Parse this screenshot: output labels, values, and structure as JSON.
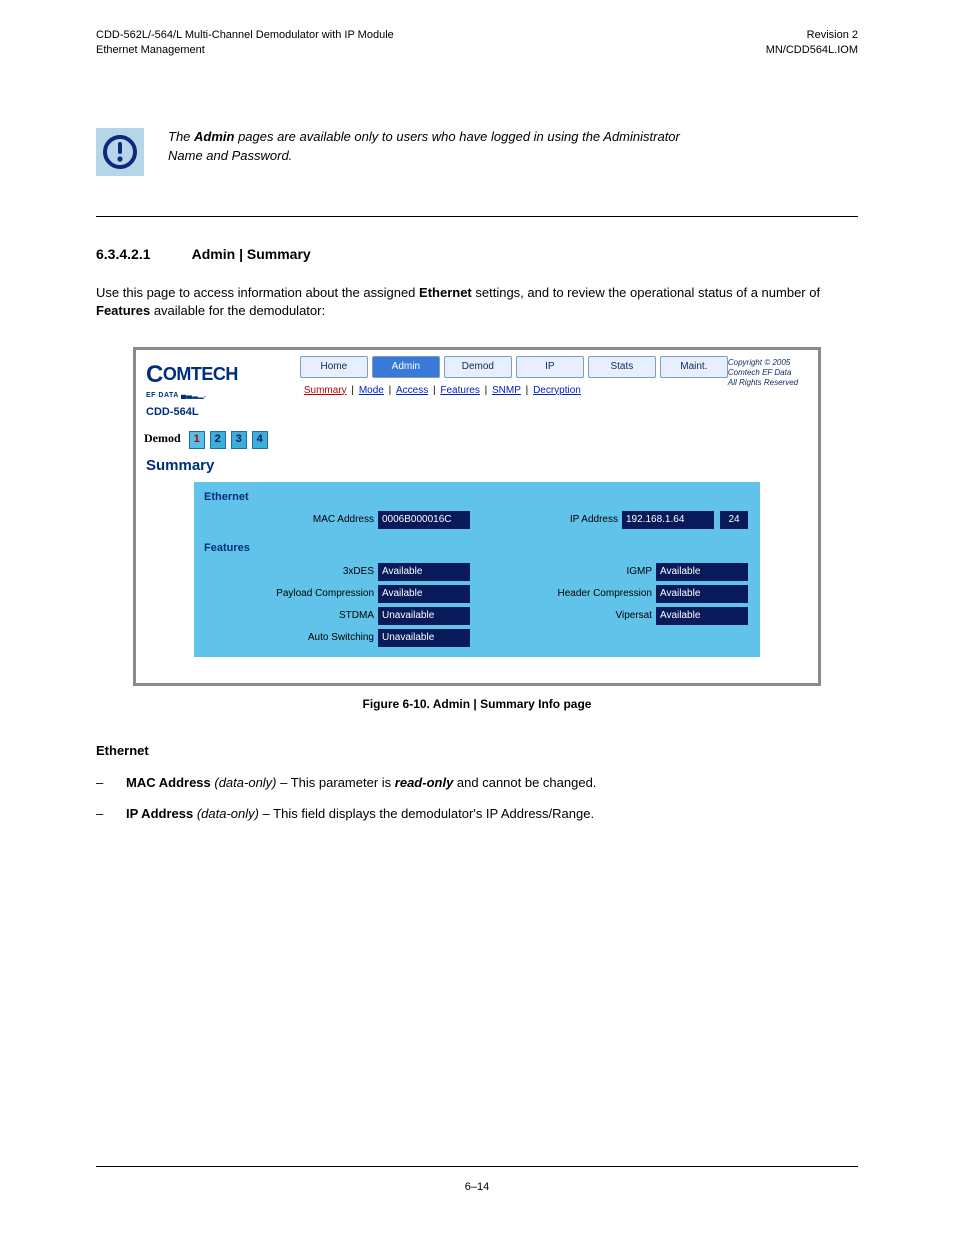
{
  "page_header": {
    "left_line1": "CDD-562L/-564/L Multi-Channel Demodulator with IP Module",
    "left_line2": "Ethernet Management",
    "right_line1": "Revision 2",
    "right_line2": "MN/CDD564L.IOM"
  },
  "notice": {
    "line1_prefix": "The ",
    "line1_italic": "Admin ",
    "line1_rest": "pages are available only to users who have logged in using the Administrator ",
    "line2": "Name and Password."
  },
  "section": {
    "number": "6.3.4.2.1",
    "title": "Admin | Summary",
    "desc_prefix": "Use this page to access information about the assigned ",
    "desc_bold1": "Ethernet",
    "desc_mid": " settings, and to review the operational status of a number of ",
    "desc_bold2": "Features",
    "desc_suffix": " available for the demodulator:"
  },
  "shot": {
    "model": "CDD-564L",
    "tabs": [
      "Home",
      "Admin",
      "Demod",
      "IP",
      "Stats",
      "Maint."
    ],
    "active_tab_index": 1,
    "subnav": [
      "Summary",
      "Mode",
      "Access",
      "Features",
      "SNMP",
      "Decryption"
    ],
    "subnav_active_index": 0,
    "copyright": [
      "Copyright © 2005",
      "Comtech EF Data",
      "All Rights Reserved"
    ],
    "demod_label": "Demod",
    "demod_badges": [
      "1",
      "2",
      "3",
      "4"
    ],
    "demod_selected_index": 0,
    "summary_title": "Summary",
    "ethernet_title": "Ethernet",
    "mac_label": "MAC Address",
    "mac_value": "0006B000016C",
    "ip_label": "IP Address",
    "ip_value": "192.168.1.64",
    "ip_mask": "24",
    "features_title": "Features",
    "features": [
      {
        "label": "3xDES",
        "value": "Available"
      },
      {
        "label": "IGMP",
        "value": "Available"
      },
      {
        "label": "Payload Compression",
        "value": "Available"
      },
      {
        "label": "Header Compression",
        "value": "Available"
      },
      {
        "label": "STDMA",
        "value": "Unavailable"
      },
      {
        "label": "Vipersat",
        "value": "Available"
      },
      {
        "label": "Auto Switching",
        "value": "Unavailable"
      }
    ]
  },
  "figure_caption": "Figure 6-10. Admin | Summary Info page",
  "ethernet_block": {
    "heading": "Ethernet",
    "mac_line_lead": "MAC Address",
    "mac_line_italic": " (data-only)",
    "mac_line_tail": " – This parameter is ",
    "mac_line_bold": "read-only",
    "mac_line_end": " and cannot be changed. ",
    "ip_line_lead": "IP Address",
    "ip_line_italic": " (data-only)",
    "ip_line_tail": " – This field displays the demodulator's IP Address/Range."
  },
  "footer": {
    "left": "",
    "center": "6–14",
    "right": ""
  }
}
